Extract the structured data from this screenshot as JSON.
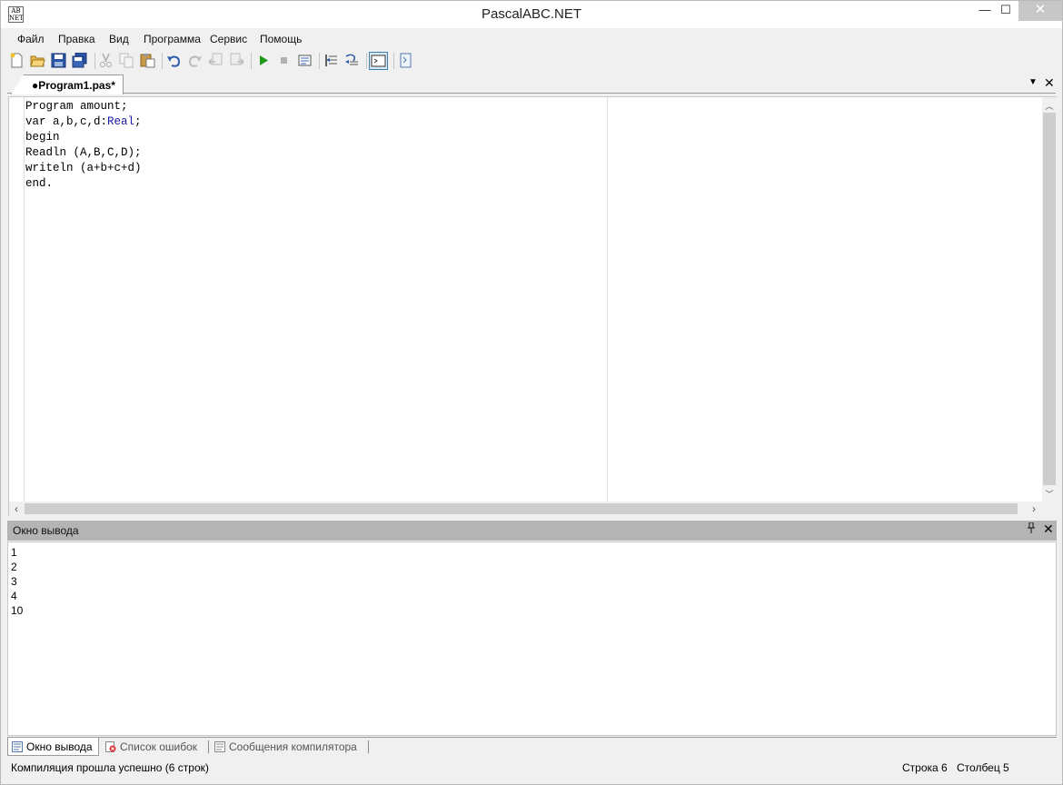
{
  "window": {
    "title": "PascalABC.NET",
    "icon_text_top": "AB",
    "icon_text_bottom": "NET",
    "minimize_glyph": "—",
    "maximize_glyph": "☐",
    "close_glyph": "✕"
  },
  "menu": {
    "items": [
      "Файл",
      "Правка",
      "Вид",
      "Программа",
      "Сервис",
      "Помощь"
    ]
  },
  "toolbar": {
    "icons": [
      "new-file-icon",
      "open-folder-icon",
      "save-icon",
      "save-all-icon",
      "cut-icon",
      "copy-icon",
      "paste-icon",
      "undo-icon",
      "redo-icon",
      "navigate-back-icon",
      "navigate-forward-icon",
      "run-icon",
      "stop-icon",
      "debug-icon",
      "step-into-icon",
      "step-over-icon",
      "console-window-icon",
      "form-designer-icon"
    ]
  },
  "editor": {
    "tab_label": "●Program1.pas*",
    "tab_dropdown_glyph": "▼",
    "tab_close_glyph": "✕",
    "code_lines": [
      "Program amount;",
      "var a,b,c,d:",
      "begin",
      "Readln (A,B,C,D);",
      "writeln (a+b+c+d)",
      "end."
    ],
    "type_keyword": "Real",
    "line2_suffix": ";"
  },
  "output_panel": {
    "title": "Окно вывода",
    "pin_glyph": "📌",
    "close_glyph": "✕",
    "lines": [
      "1",
      "2",
      "3",
      "4",
      "10"
    ]
  },
  "bottom_tabs": [
    {
      "label": "Окно вывода",
      "active": true
    },
    {
      "label": "Список ошибок",
      "active": false
    },
    {
      "label": "Сообщения компилятора",
      "active": false
    }
  ],
  "status": {
    "message": "Компиляция прошла успешно (6 строк)",
    "row": "Строка  6",
    "column": "Столбец  5"
  },
  "colors": {
    "type_keyword": "#1a1aa6",
    "run_green": "#1c9a1c",
    "output_header": "#b4b4b4"
  }
}
